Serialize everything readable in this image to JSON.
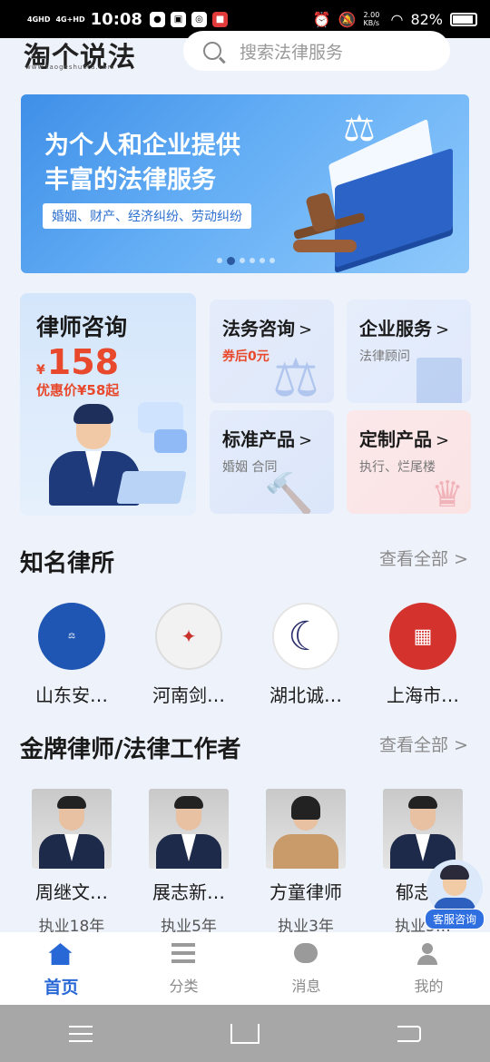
{
  "status_bar": {
    "signal1": "4GHD",
    "signal2": "4G+HD",
    "time": "10:08",
    "speed": "2.00 KB/s",
    "battery": "82%"
  },
  "header": {
    "logo": "淘个说法",
    "logo_sub": "www.taogeshuofa.com",
    "search_placeholder": "搜索法律服务"
  },
  "banner": {
    "title_line1": "为个人和企业提供",
    "title_line2": "丰富的法律服务",
    "tag": "婚姻、财产、经济纠纷、劳动纠纷"
  },
  "services": {
    "main": {
      "title": "律师咨询",
      "currency": "¥",
      "price": "158",
      "discount": "优惠价¥58起"
    },
    "items": [
      {
        "title": "法务咨询",
        "desc": "券后0元"
      },
      {
        "title": "企业服务",
        "desc": "法律顾问"
      },
      {
        "title": "标准产品",
        "desc": "婚姻 合同"
      },
      {
        "title": "定制产品",
        "desc": "执行、烂尾楼"
      }
    ],
    "arrow": ">"
  },
  "firms_section": {
    "title": "知名律所",
    "more": "查看全部 >",
    "items": [
      {
        "name": "山东安…",
        "logo_color": "#1f56b3"
      },
      {
        "name": "河南剑…",
        "logo_color": "#c8312c"
      },
      {
        "name": "湖北诚…",
        "logo_color": "#2a2f6b"
      },
      {
        "name": "上海市…",
        "logo_color": "#d4322d"
      }
    ]
  },
  "lawyers_section": {
    "title": "金牌律师/法律工作者",
    "more": "查看全部 >",
    "items": [
      {
        "name": "周继文…",
        "years": "执业18年"
      },
      {
        "name": "展志新…",
        "years": "执业5年"
      },
      {
        "name": "方童律师",
        "years": "执业3年"
      },
      {
        "name": "郁志…",
        "years": "执业5…"
      }
    ]
  },
  "support": {
    "label": "客服咨询"
  },
  "tabbar": {
    "tabs": [
      {
        "label": "首页",
        "icon": "home-icon"
      },
      {
        "label": "分类",
        "icon": "list-icon"
      },
      {
        "label": "消息",
        "icon": "message-icon"
      },
      {
        "label": "我的",
        "icon": "user-icon"
      }
    ]
  },
  "colors": {
    "accent": "#2767d6",
    "price_red": "#e8492c"
  }
}
